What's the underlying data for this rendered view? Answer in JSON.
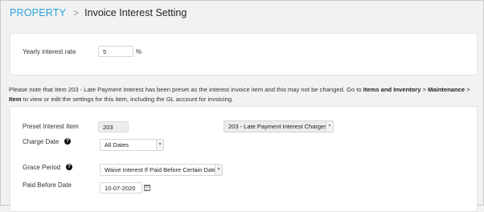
{
  "breadcrumb": {
    "root": "PROPERTY",
    "separator": ">",
    "title": "Invoice Interest Setting"
  },
  "interest": {
    "label": "Yearly interest rate",
    "value": "5",
    "unit": "%"
  },
  "note": {
    "part1": "Please note that Item 203 - Late Payment Interest has been preset as the interest invoice item and this may not be changed. Go to ",
    "link1": "Items and Inventory",
    "sep1": " > ",
    "link2": "Maintenance",
    "sep2": " > ",
    "link3": "Item",
    "part2": " to view or edit the settings for this item, including the GL account for invoicing."
  },
  "form": {
    "preset_label": "Preset Interest Item",
    "preset_code": "203",
    "preset_item": "203 - Late Payment Interest Charges",
    "charge_date_label": "Charge Date",
    "charge_date_value": "All Dates",
    "grace_label": "Grace Period",
    "grace_value": "Waive Interest If Paid Before Certain Date",
    "paid_before_label": "Paid Before Date",
    "paid_before_value": "10-07-2020"
  },
  "icons": {
    "help": "question-circle-icon",
    "calendar": "calendar-icon",
    "dropdown": "chevron-down-icon"
  },
  "colors": {
    "accent": "#2aa3d9"
  }
}
